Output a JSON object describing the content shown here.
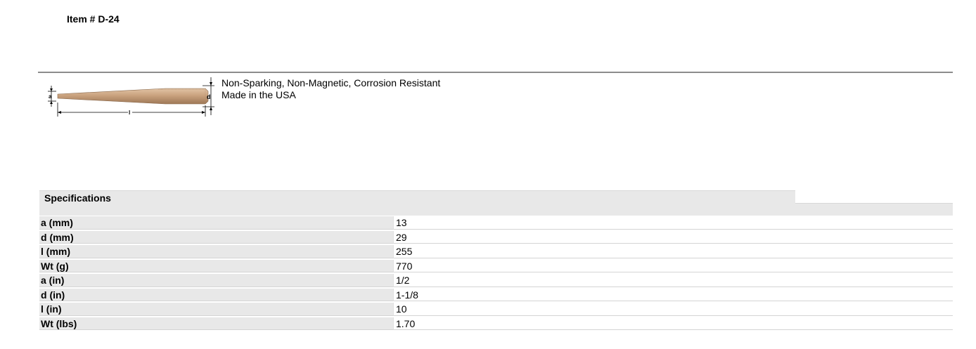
{
  "item": {
    "title": "Item # D-24"
  },
  "product": {
    "image_icon": "tapered-drift-punch-diagram",
    "image_labels": {
      "a": "a",
      "d": "d",
      "l": "l"
    },
    "features": [
      "Non-Sparking, Non-Magnetic, Corrosion Resistant",
      "Made in the USA"
    ]
  },
  "specifications": {
    "title": "Specifications",
    "rows": [
      {
        "label": "a (mm)",
        "value": "13"
      },
      {
        "label": "d (mm)",
        "value": "29"
      },
      {
        "label": "l (mm)",
        "value": "255"
      },
      {
        "label": "Wt (g)",
        "value": "770"
      },
      {
        "label": "a (in)",
        "value": "1/2"
      },
      {
        "label": "d (in)",
        "value": "1-1/8"
      },
      {
        "label": "l (in)",
        "value": "10"
      },
      {
        "label": "Wt (lbs)",
        "value": "1.70"
      }
    ]
  },
  "colors": {
    "header_bg": "#e8e8e8",
    "rule": "#8c8c8c",
    "tool_bronze": "#c9a27e"
  }
}
